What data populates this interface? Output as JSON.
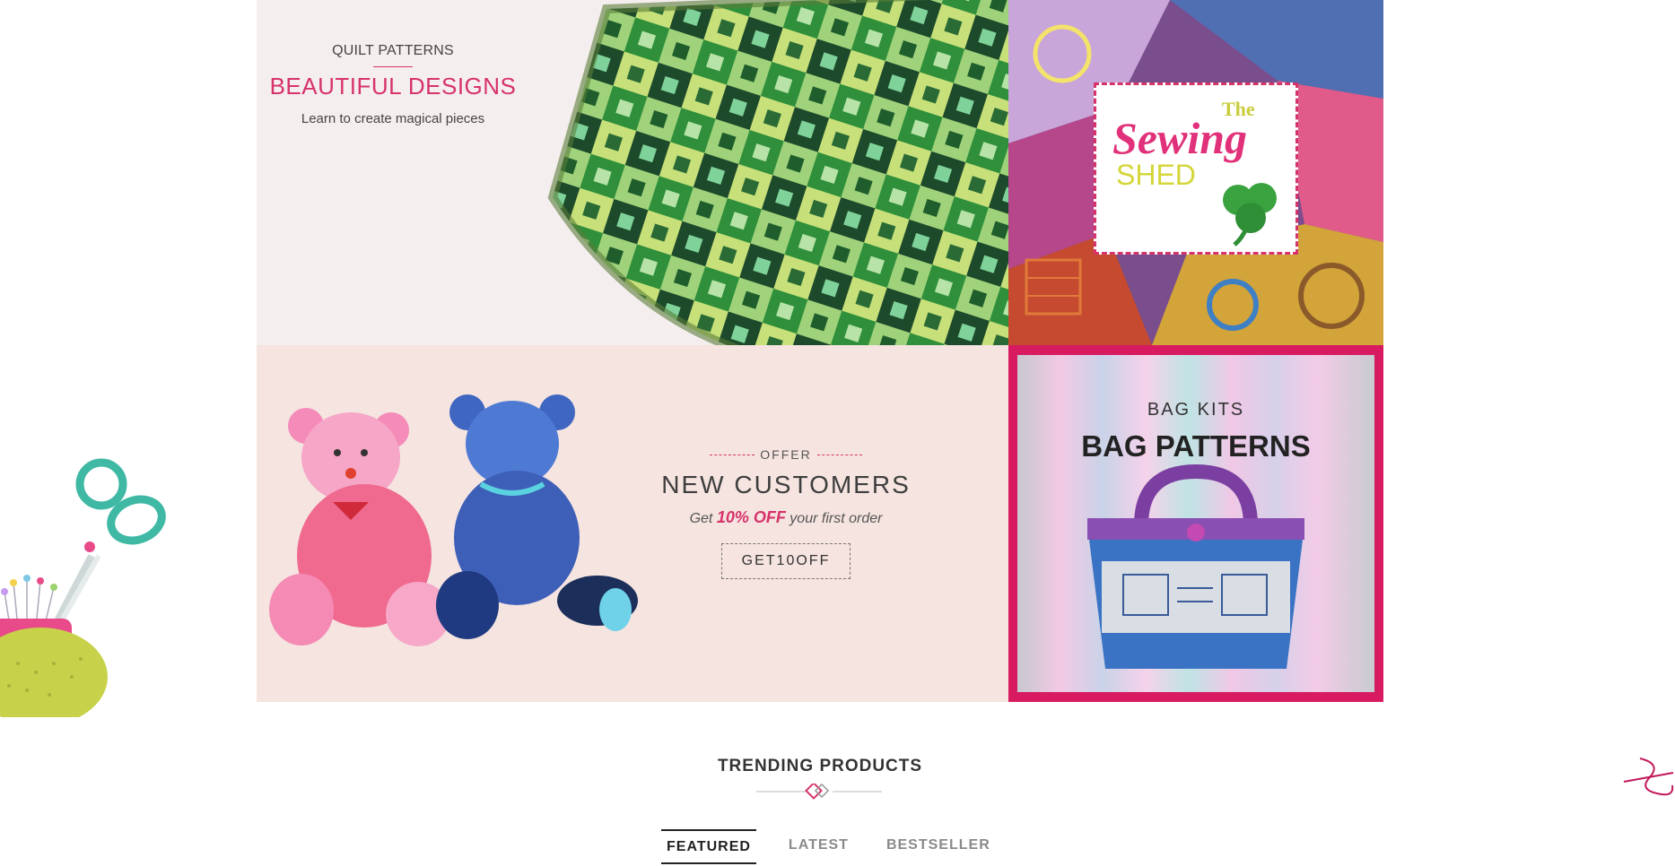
{
  "banners": {
    "quilt": {
      "eyebrow": "QUILT PATTERNS",
      "title": "BEAUTIFUL DESIGNS",
      "subtitle": "Learn to create magical pieces"
    },
    "shed": {
      "logo_the": "The",
      "logo_sewing": "Sewing",
      "logo_shed": "SHED"
    },
    "offer": {
      "eyebrow": "OFFER",
      "title": "NEW CUSTOMERS",
      "sub_before": "Get",
      "sub_highlight": "10% OFF",
      "sub_after": "your first order",
      "code_button": "GET10OFF"
    },
    "bag": {
      "eyebrow": "BAG KITS",
      "title": "BAG PATTERNS"
    }
  },
  "trending": {
    "title": "TRENDING PRODUCTS",
    "tabs": [
      {
        "label": "FEATURED",
        "active": true
      },
      {
        "label": "LATEST",
        "active": false
      },
      {
        "label": "BESTSELLER",
        "active": false
      }
    ]
  },
  "colors": {
    "accent": "#d6336c",
    "bag_frame": "#d81b60",
    "quilt_bg": "#f5eeee",
    "offer_bg": "#f5e4e0"
  },
  "icons": [
    "scissors-pincushion-icon",
    "diamond-icon",
    "needle-thread-icon",
    "shamrock-icon"
  ]
}
